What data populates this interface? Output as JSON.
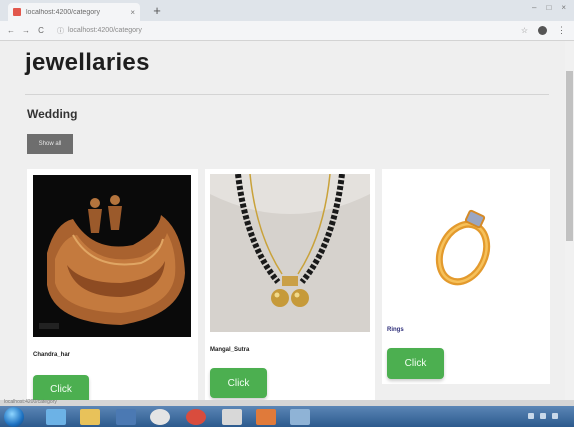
{
  "browser": {
    "tab_title": "localhost:4200/category",
    "tab_close": "×",
    "new_tab": "+",
    "window_controls": [
      "–",
      "□",
      "×"
    ],
    "url": "localhost:4200/category",
    "nav": {
      "back": "←",
      "forward": "→",
      "reload": "C"
    },
    "star": "☆",
    "menu": "⋮"
  },
  "page": {
    "title": "jewellaries",
    "section_title": "Wedding",
    "show_all_label": "Show all"
  },
  "products": [
    {
      "name": "Chandra_har",
      "button_label": "Click",
      "image_icon": "necklace-image"
    },
    {
      "name": "Mangal_Sutra",
      "button_label": "Click",
      "image_icon": "mangalsutra-image"
    },
    {
      "name": "Rings",
      "button_label": "Click",
      "image_icon": "ring-image"
    }
  ],
  "colors": {
    "accent_button": "#4caf50",
    "show_all_bg": "#6e6e6e",
    "page_bg": "#efefef"
  }
}
